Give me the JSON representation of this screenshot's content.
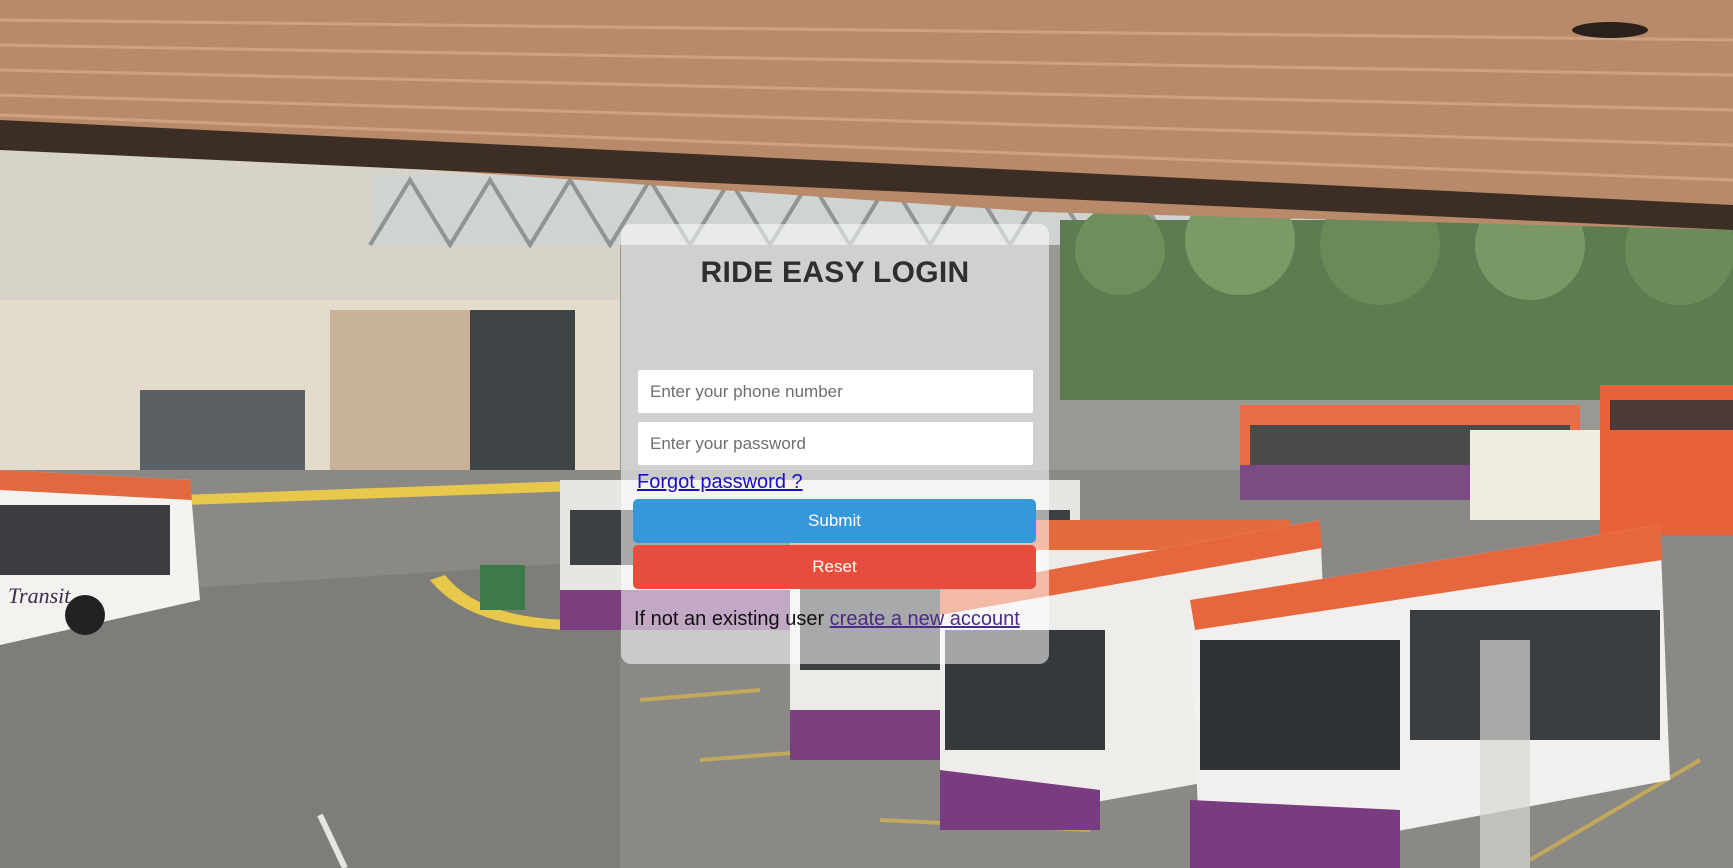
{
  "login": {
    "title": "RIDE EASY LOGIN",
    "phone_placeholder": "Enter your phone number",
    "phone_value": "",
    "password_placeholder": "Enter your password",
    "password_value": "",
    "forgot_label": "Forgot password ?",
    "submit_label": "Submit",
    "reset_label": "Reset",
    "signup_prompt": "If not an existing user ",
    "signup_link_label": "create a new account"
  },
  "colors": {
    "submit": "#3498db",
    "reset": "#e74c3c",
    "link": "#1a0dcc",
    "visited_link": "#4b2a8a"
  },
  "background": {
    "image_description_icon": "bus-depot-photo"
  }
}
